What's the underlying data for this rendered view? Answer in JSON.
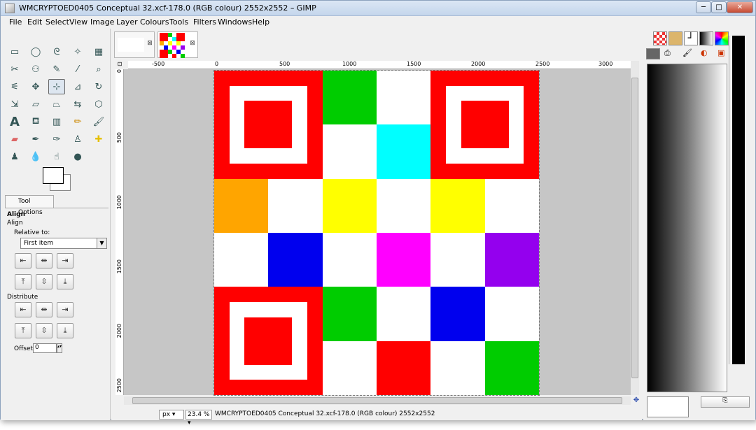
{
  "window": {
    "title": "WMCRYPTOED0405 Conceptual 32.xcf-178.0 (RGB colour) 2552x2552 – GIMP",
    "min": "─",
    "max": "□",
    "close": "✕"
  },
  "menu": [
    "File",
    "Edit",
    "Select",
    "View",
    "Image",
    "Layer",
    "Colours",
    "Tools",
    "Filters",
    "Windows",
    "Help"
  ],
  "toolbox": {
    "tool_options_tab": "Tool Options",
    "section": "Align",
    "subsection": "Align",
    "relative_to_label": "Relative to:",
    "relative_to_value": "First item",
    "distribute_label": "Distribute",
    "offset_label": "Offset:",
    "offset_value": "0"
  },
  "ruler": {
    "h_ticks": [
      "-500",
      "0",
      "500",
      "1000",
      "1500",
      "2000",
      "2500",
      "3000"
    ],
    "v_ticks": [
      "0",
      "500",
      "1000",
      "1500",
      "2000",
      "2500"
    ]
  },
  "status": {
    "unit": "px",
    "zoom": "23.4 %",
    "text": "WMCRYPTOED0405 Conceptual 32.xcf-178.0 (RGB colour) 2552x2552"
  },
  "colors": {
    "red": "#ff0000",
    "green": "#00cc00",
    "cyan": "#00ffff",
    "orange": "#ffa500",
    "yellow": "#ffff00",
    "blue": "#0000ee",
    "magenta": "#ff00ff",
    "purple": "#9400ee",
    "white": "#ffffff"
  },
  "grid": [
    [
      "F",
      "F",
      "green",
      "white",
      "F",
      "F"
    ],
    [
      "F",
      "F",
      "white",
      "cyan",
      "F",
      "F"
    ],
    [
      "orange",
      "white",
      "yellow",
      "white",
      "yellow",
      "white"
    ],
    [
      "white",
      "blue",
      "white",
      "magenta",
      "white",
      "purple"
    ],
    [
      "F",
      "F",
      "green",
      "white",
      "blue",
      "white"
    ],
    [
      "F",
      "F",
      "white",
      "red",
      "white",
      "green"
    ]
  ]
}
